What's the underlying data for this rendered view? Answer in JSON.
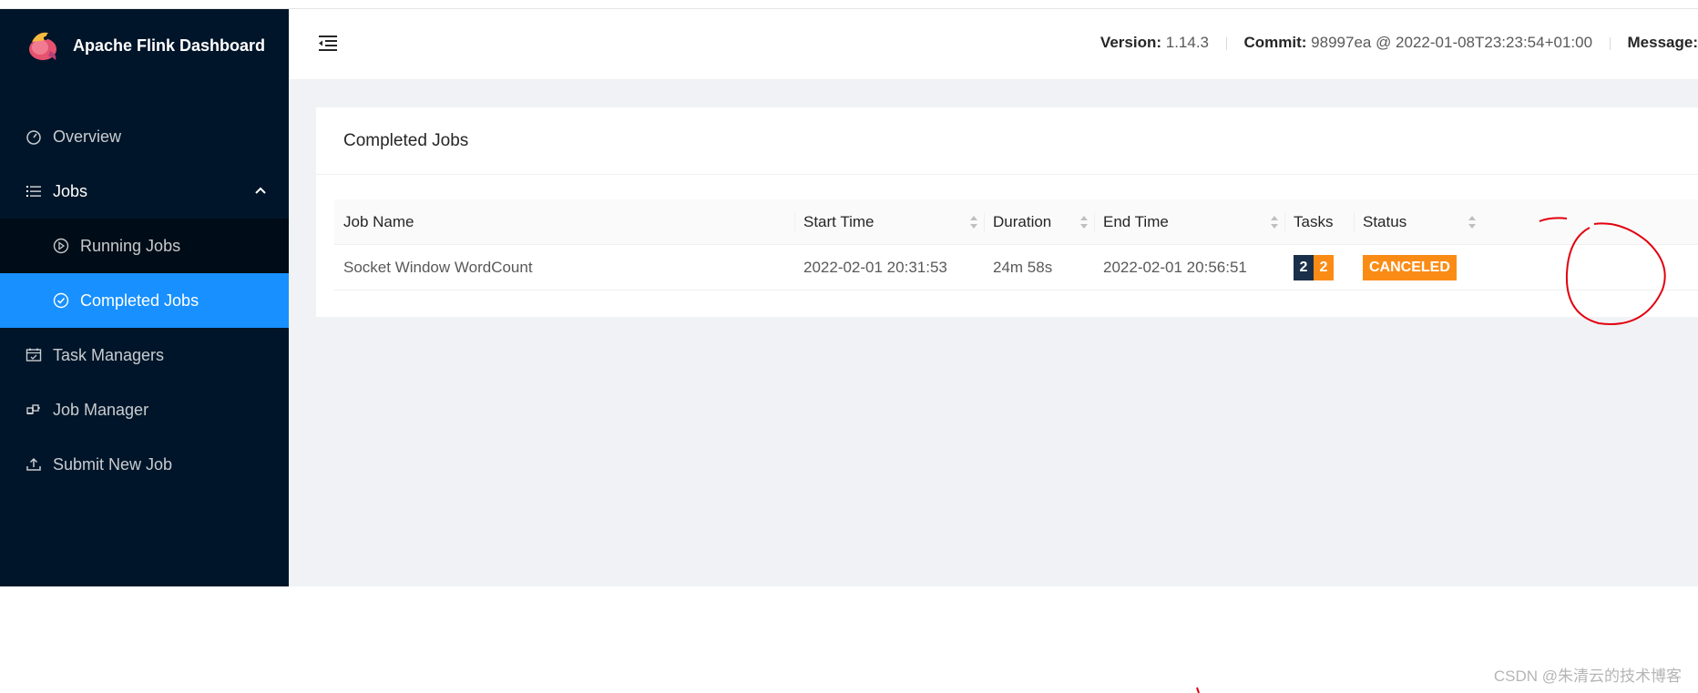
{
  "app": {
    "title": "Apache Flink Dashboard"
  },
  "sidebar": {
    "items": [
      {
        "label": "Overview",
        "icon": "dashboard-icon"
      },
      {
        "label": "Jobs",
        "icon": "list-icon"
      },
      {
        "label": "Running Jobs",
        "icon": "play-circle-icon"
      },
      {
        "label": "Completed Jobs",
        "icon": "check-circle-icon"
      },
      {
        "label": "Task Managers",
        "icon": "schedule-icon"
      },
      {
        "label": "Job Manager",
        "icon": "build-icon"
      },
      {
        "label": "Submit New Job",
        "icon": "upload-icon"
      }
    ]
  },
  "header": {
    "version_label": "Version:",
    "version": "1.14.3",
    "commit_label": "Commit:",
    "commit": "98997ea @ 2022-01-08T23:23:54+01:00",
    "message_label": "Message:"
  },
  "card": {
    "title": "Completed Jobs"
  },
  "table": {
    "columns": [
      "Job Name",
      "Start Time",
      "Duration",
      "End Time",
      "Tasks",
      "Status"
    ],
    "rows": [
      {
        "job_name": "Socket Window WordCount",
        "start_time": "2022-02-01 20:31:53",
        "duration": "24m 58s",
        "end_time": "2022-02-01 20:56:51",
        "tasks_total": "2",
        "tasks_canceled": "2",
        "status": "CANCELED"
      }
    ]
  },
  "colors": {
    "sidebar_bg": "#001529",
    "active_blue": "#1890ff",
    "total_badge": "#1a2f49",
    "canceled_orange": "#fa8c16",
    "annotation_red": "#e3000e"
  },
  "watermark": "CSDN @朱清云的技术博客"
}
